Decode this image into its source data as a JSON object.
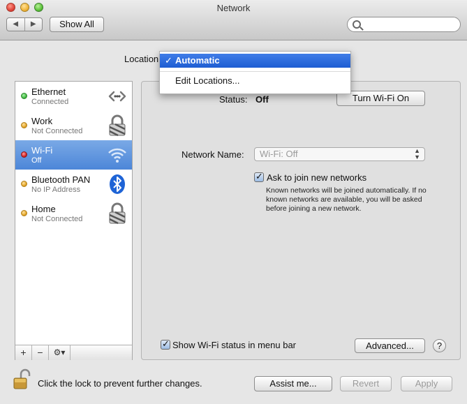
{
  "window": {
    "title": "Network"
  },
  "toolbar": {
    "back": "◀",
    "forward": "▶",
    "show_all": "Show All",
    "search_placeholder": ""
  },
  "location": {
    "label": "Location:",
    "options": [
      "Automatic",
      "Edit Locations..."
    ],
    "selected": "Automatic",
    "check": "✓"
  },
  "services": [
    {
      "name": "Ethernet",
      "status": "Connected",
      "dot_color": "#3cb43c",
      "icon": "ethernet-icon"
    },
    {
      "name": "Work",
      "status": "Not Connected",
      "dot_color": "#e0a020",
      "icon": "lock-icon"
    },
    {
      "name": "Wi-Fi",
      "status": "Off",
      "dot_color": "#d02020",
      "icon": "wifi-icon",
      "selected": true
    },
    {
      "name": "Bluetooth PAN",
      "status": "No IP Address",
      "dot_color": "#e0a020",
      "icon": "bluetooth-icon"
    },
    {
      "name": "Home",
      "status": "Not Connected",
      "dot_color": "#e0a020",
      "icon": "lock-icon"
    }
  ],
  "sidebar_buttons": {
    "add": "+",
    "remove": "−",
    "gear": "⚙▾"
  },
  "detail": {
    "status_label": "Status:",
    "status_value": "Off",
    "turn_on_button": "Turn Wi-Fi On",
    "network_name_label": "Network Name:",
    "network_name_value": "Wi-Fi: Off",
    "ask_to_join": "Ask to join new networks",
    "ask_to_join_checked": true,
    "ask_to_join_note": "Known networks will be joined automatically. If no known networks are available, you will be asked before joining a new network.",
    "show_status": "Show Wi-Fi status in menu bar",
    "show_status_checked": true,
    "advanced_button": "Advanced...",
    "help": "?"
  },
  "footer": {
    "lock_text": "Click the lock to prevent further changes.",
    "assist_button": "Assist me...",
    "revert_button": "Revert",
    "apply_button": "Apply"
  },
  "colors": {
    "selection": "#4c86d8",
    "menu_highlight": "#1e5dd2"
  }
}
